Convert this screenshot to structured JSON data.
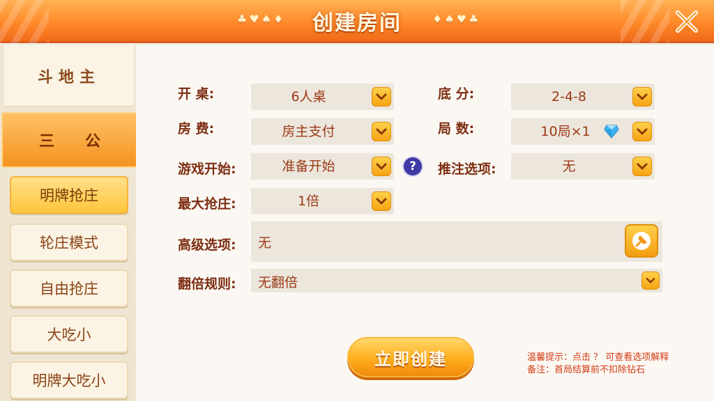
{
  "header": {
    "title": "创建房间",
    "suits_left": "♣♥♠♦",
    "suits_right": "♦♠♥♣"
  },
  "sidebar": {
    "top_item": "斗地主",
    "active_item": "三公",
    "sub_items": [
      "明牌抢庄",
      "轮庄模式",
      "自由抢庄",
      "大吃小",
      "明牌大吃小"
    ]
  },
  "form": {
    "kai_zhuo": {
      "label": "开    桌:",
      "value": "6人桌"
    },
    "di_fen": {
      "label": "底    分:",
      "value": "2-4-8"
    },
    "fang_fei": {
      "label": "房    费:",
      "value": "房主支付"
    },
    "ju_shu": {
      "label": "局    数:",
      "value": "10局×1"
    },
    "start_mode": {
      "label": "游戏开始:",
      "value": "准备开始",
      "help": "?"
    },
    "push_bet": {
      "label": "推注选项:",
      "value": "无"
    },
    "max_grab": {
      "label": "最大抢庄:",
      "value": "1倍"
    },
    "advanced": {
      "label": "高级选项:",
      "value": "无"
    },
    "double_rule": {
      "label": "翻倍规则:",
      "value": "无翻倍"
    }
  },
  "create_button": "立即创建",
  "tips": {
    "line1": "温馨提示：点击 ？ 可查看选项解释",
    "line2": "备注：首局结算前不扣除钻石"
  },
  "colors": {
    "accent": "#f5931f",
    "label": "#7d2d12",
    "value": "#9b3a16",
    "tip": "#d43a14"
  }
}
